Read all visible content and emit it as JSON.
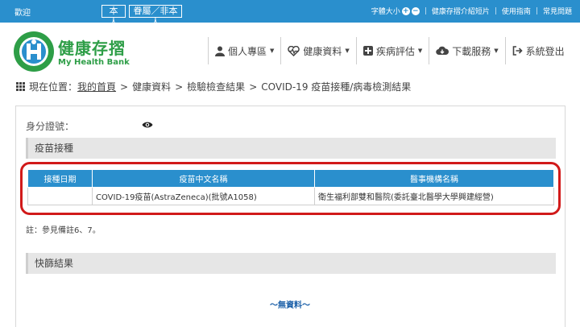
{
  "topbar": {
    "welcome": "歡迎",
    "identity_self": "本人",
    "identity_other": "眷屬／非本人",
    "font_size_label": "字體大小",
    "font_increase": "+",
    "font_decrease": "−",
    "links": [
      "健康存摺介紹短片",
      "使用指南",
      "常見問題"
    ]
  },
  "brand": {
    "name_zh": "健康存摺",
    "name_en": "My Health Bank"
  },
  "nav": {
    "items": [
      {
        "label": "個人專區",
        "icon": "user-icon",
        "has_caret": true
      },
      {
        "label": "健康資料",
        "icon": "heart-pulse-icon",
        "has_caret": true
      },
      {
        "label": "疾病評估",
        "icon": "plus-square-icon",
        "has_caret": true
      },
      {
        "label": "下載服務",
        "icon": "cloud-download-icon",
        "has_caret": true
      },
      {
        "label": "系統登出",
        "icon": "sign-out-icon",
        "has_caret": false
      }
    ],
    "caret": "▼"
  },
  "breadcrumb": {
    "prefix": "現在位置：",
    "sep": ">",
    "home": "我的首頁",
    "items": [
      "健康資料",
      "檢驗檢查結果",
      "COVID-19 疫苗接種/病毒檢測結果"
    ]
  },
  "id_label": "身分證號：",
  "vaccine_section": {
    "title": "疫苗接種",
    "headers": [
      "接種日期",
      "疫苗中文名稱",
      "醫事機構名稱"
    ],
    "rows": [
      [
        "",
        "COVID-19疫苗(AstraZeneca)(批號A1058)",
        "衛生福利部雙和醫院(委託臺北醫學大學興建經營)"
      ]
    ]
  },
  "note": "註：參見備註6、7。",
  "rapid_section": {
    "title": "快篩結果",
    "no_data": "～無資料～"
  },
  "colors": {
    "primary_blue": "#2a8fcd",
    "brand_green": "#2e9e47",
    "highlight_red": "#d11a1a",
    "section_gray": "#e6e6e6"
  }
}
